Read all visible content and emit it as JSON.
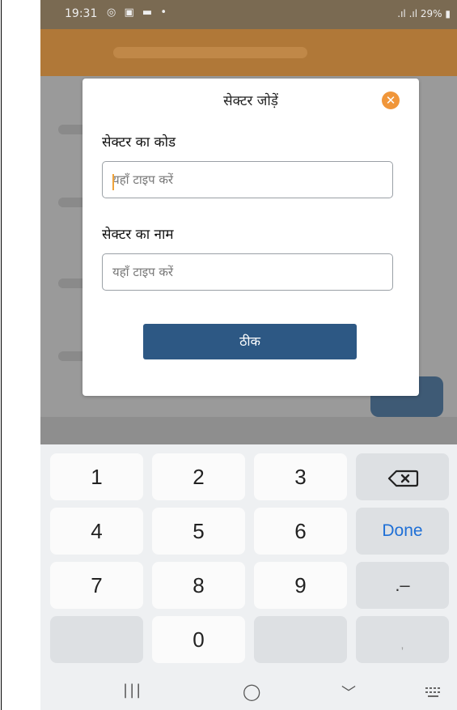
{
  "status_bar": {
    "time": "19:31",
    "left_icons": "whatsapp-icon gallery-icon message-icon",
    "right_text": "Vo LTE ..ll Vo LTE ..ll 29%",
    "battery": "29%"
  },
  "dialog": {
    "title": "सेक्टर जोड़ें",
    "close_icon": "close-circle-icon",
    "fields": [
      {
        "label": "सेक्टर का कोड",
        "placeholder": "यहाँ टाइप करें",
        "value": ""
      },
      {
        "label": "सेक्टर का नाम",
        "placeholder": "यहाँ टाइप करें",
        "value": ""
      }
    ],
    "ok_label": "ठीक"
  },
  "keyboard": {
    "rows": [
      [
        "1",
        "2",
        "3",
        "⌫"
      ],
      [
        "4",
        "5",
        "6",
        "Done"
      ],
      [
        "7",
        "8",
        "9",
        ".–"
      ],
      [
        "",
        "0",
        "",
        ","
      ]
    ],
    "accent_color": "#1e6fd6"
  },
  "nav_bar": {
    "recents": "|||",
    "home": "◯",
    "back": "﹀",
    "keyboard_icon": "keyboard-icon"
  }
}
